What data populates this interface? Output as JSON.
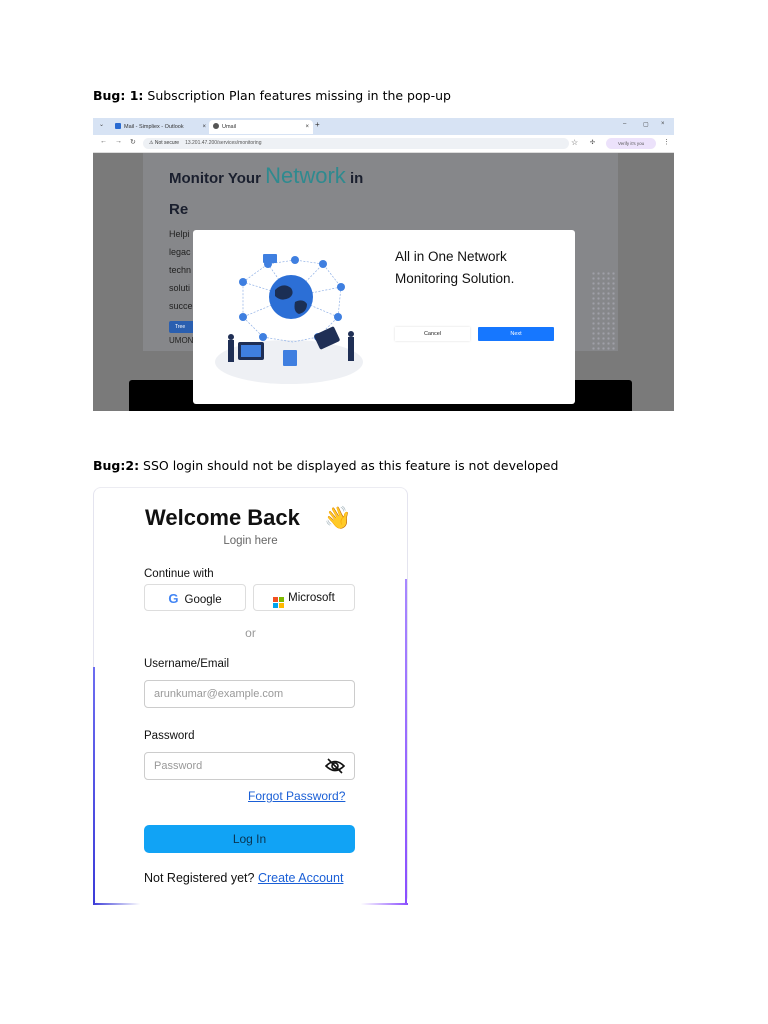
{
  "bug1": {
    "prefix": "Bug: 1:",
    "text": " Subscription Plan features missing in the pop-up"
  },
  "bug2": {
    "prefix": "Bug:2:",
    "text": " SSO login should not be displayed as this feature is not developed"
  },
  "browser": {
    "tab1": "Mail - Simpliex - Outlook",
    "tab2": "Umail",
    "tab_close": "×",
    "new_tab": "+",
    "not_secure": "Not secure",
    "url": "13.201.47.200/services/monitoring",
    "verify": "Verify it's you",
    "minimize": "–",
    "restore": "▢",
    "close": "×"
  },
  "hero": {
    "title_prefix": "Monitor Your",
    "title_highlight": "Network",
    "title_suffix": "in",
    "line2": "Re",
    "body_lines": [
      "Helpi",
      "legac",
      "techn",
      "soluti",
      "succe"
    ],
    "cta": "Tree",
    "brand_partial": "UMON"
  },
  "modal": {
    "title": "All in One Network Monitoring Solution.",
    "cancel": "Cancel",
    "next": "Next"
  },
  "login": {
    "title": "Welcome Back",
    "emoji": "👋",
    "subtitle": "Login here",
    "continue_with": "Continue with",
    "google": "Google",
    "microsoft": "Microsoft",
    "or": "or",
    "username_label": "Username/Email",
    "username_placeholder": "arunkumar@example.com",
    "password_label": "Password",
    "password_placeholder": "Password",
    "forgot": "Forgot Password?",
    "login_button": "Log In",
    "not_registered": "Not Registered yet?",
    "create_account": "Create Account"
  },
  "colors": {
    "primary_blue": "#1677ff",
    "login_button": "#11a3f5",
    "link": "#1a5fd6",
    "network_teal": "#2f8a8f"
  }
}
